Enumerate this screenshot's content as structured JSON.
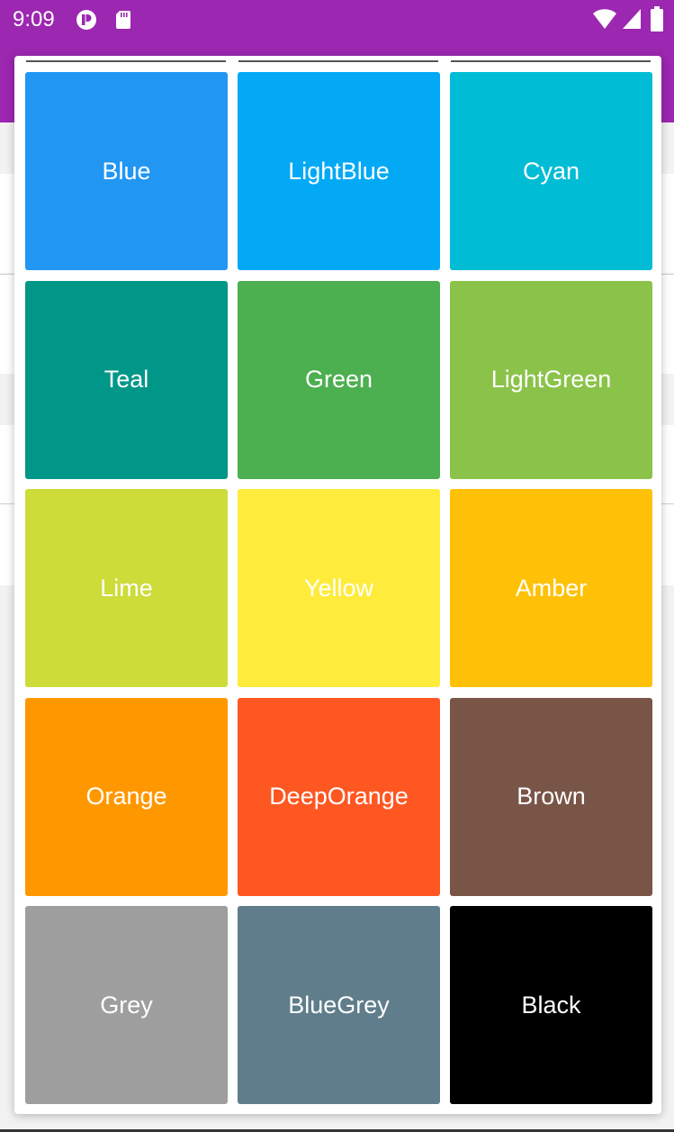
{
  "status_bar": {
    "time": "9:09",
    "icons": [
      "cast-icon",
      "sd-card-icon",
      "wifi-icon",
      "signal-icon",
      "battery-icon"
    ]
  },
  "colors": {
    "app_bar": "#9c27b0",
    "dialog_bg": "#ffffff",
    "page_bg": "#f2f2f2"
  },
  "palette": [
    {
      "label": "Blue",
      "color": "#2196f3"
    },
    {
      "label": "LightBlue",
      "color": "#03a9f4"
    },
    {
      "label": "Cyan",
      "color": "#00bcd4"
    },
    {
      "label": "Teal",
      "color": "#009688"
    },
    {
      "label": "Green",
      "color": "#4caf50"
    },
    {
      "label": "LightGreen",
      "color": "#8bc34a"
    },
    {
      "label": "Lime",
      "color": "#cddc39"
    },
    {
      "label": "Yellow",
      "color": "#ffeb3b"
    },
    {
      "label": "Amber",
      "color": "#ffc107"
    },
    {
      "label": "Orange",
      "color": "#ff9800"
    },
    {
      "label": "DeepOrange",
      "color": "#ff5722"
    },
    {
      "label": "Brown",
      "color": "#795548"
    },
    {
      "label": "Grey",
      "color": "#9e9e9e"
    },
    {
      "label": "BlueGrey",
      "color": "#607d8b"
    },
    {
      "label": "Black",
      "color": "#000000"
    }
  ]
}
